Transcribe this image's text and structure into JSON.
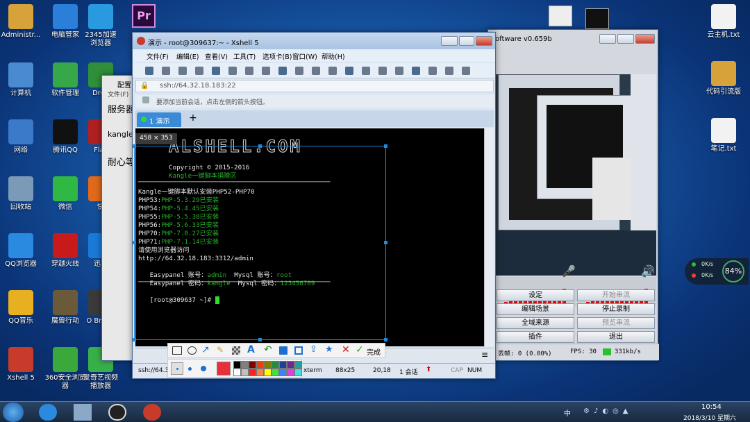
{
  "desktop_icons": [
    {
      "label": "Administr...",
      "color": "#d8a23a"
    },
    {
      "label": "电脑管家",
      "color": "#2a7fd8"
    },
    {
      "label": "2345加速浏览器",
      "color": "#2a9ae0"
    },
    {
      "label": "计算机",
      "color": "#4a8ad0"
    },
    {
      "label": "软件管理",
      "color": "#37a84a"
    },
    {
      "label": "Drea",
      "color": "#2f8f3a"
    },
    {
      "label": "网络",
      "color": "#3a7ac8"
    },
    {
      "label": "腾讯QQ",
      "color": "#111111"
    },
    {
      "label": "Flas",
      "color": "#b02020"
    },
    {
      "label": "回收站",
      "color": "#7a9ab8"
    },
    {
      "label": "微信",
      "color": "#2fb843"
    },
    {
      "label": "快",
      "color": "#e06a1a"
    },
    {
      "label": "QQ浏览器",
      "color": "#2a8ae0"
    },
    {
      "label": "穿越火线",
      "color": "#c81a1a"
    },
    {
      "label": "迅雷",
      "color": "#1a7ad8"
    },
    {
      "label": "QQ音乐",
      "color": "#e8b020"
    },
    {
      "label": "魔兽行动",
      "color": "#6a5a3a"
    },
    {
      "label": "O Brows",
      "color": "#3a3a3a"
    },
    {
      "label": "Xshell 5",
      "color": "#c83a2a"
    },
    {
      "label": "360安全浏览器",
      "color": "#3aa83a"
    },
    {
      "label": "爱奇艺视频播放器",
      "color": "#38b04a"
    }
  ],
  "right_icons": [
    {
      "label": "云主机.txt"
    },
    {
      "label": "代码引流版"
    },
    {
      "label": "笔记.txt"
    }
  ],
  "bg_window": {
    "title": "配置",
    "menu": "文件(F)",
    "line1": "服务器",
    "line2": "kangle",
    "line3": "耐心等"
  },
  "right_window": {
    "title": "oftware v0.659b",
    "buttons": [
      {
        "left": "设定",
        "right": "开始串流"
      },
      {
        "left": "编辑场景",
        "right": "停止录制"
      },
      {
        "left": "全域来源",
        "right": "预览串流"
      },
      {
        "left": "插件",
        "right": "退出"
      }
    ],
    "status": {
      "drop": "丢帧: 0 (0.00%)",
      "fps": "FPS: 30",
      "rate": "331kb/s"
    }
  },
  "xshell": {
    "title": "演示 - root@309637:~ - Xshell 5",
    "menu": [
      "文件(F)",
      "编辑(E)",
      "查看(V)",
      "工具(T)",
      "选项卡(B)",
      "窗口(W)",
      "帮助(H)"
    ],
    "address": "ssh://64.32.18.183:22",
    "hint": "要添加当前会话，点击左侧的箭头按钮。",
    "tab": "1 演示",
    "status_left": "ssh://64.3",
    "status_items": [
      "xterm",
      "88x25",
      "20,18",
      "1 会话",
      "CAP",
      "NUM"
    ],
    "term": {
      "logo": "ALSHELL.COM",
      "copyright": "Copyright © 2015-2016",
      "tagline": "Kangle一键脚本捐赠区",
      "divider": "──────────────────────────────────────────────────",
      "heading": "Kangle一键脚本默认安装PHP52-PHP70",
      "php": [
        {
          "k": "PHP53:",
          "v": "PHP-5.3.29已安装"
        },
        {
          "k": "PHP54:",
          "v": "PHP-5.4.45已安装"
        },
        {
          "k": "PHP55:",
          "v": "PHP-5.5.38已安装"
        },
        {
          "k": "PHP56:",
          "v": "PHP-5.6.33已安装"
        },
        {
          "k": "PHP70:",
          "v": "PHP-7.0.27已安装"
        },
        {
          "k": "PHP71:",
          "v": "PHP-7.1.14已安装"
        }
      ],
      "access": "请使用浏览器访问",
      "url": "http://64.32.18.183:3312/admin",
      "ep_user_k": "Easypanel 账号：",
      "ep_user_v": "admin",
      "my_user_k": "  Mysql 账号：",
      "my_user_v": "root",
      "ep_pass_k": "Easypanel 密码：",
      "ep_pass_v": "kangle",
      "my_pass_k": "  Mysql 密码：",
      "my_pass_v": "123456789",
      "prompt": "[root@309637 ~]# "
    }
  },
  "snip": {
    "size": "458 × 353",
    "done": "完成",
    "accent": "#1e8ae0",
    "current_color": "#e8303a",
    "palette_top": [
      "#000000",
      "#808080",
      "#800000",
      "#e84010",
      "#808000",
      "#1f8f3f",
      "#2040a0",
      "#6a2a8a",
      "#20a0a0"
    ],
    "palette_bottom": [
      "#ffffff",
      "#c0c0c0",
      "#ff2020",
      "#ff8040",
      "#ffff00",
      "#40e040",
      "#4080ff",
      "#e040e0",
      "#40e0e0"
    ]
  },
  "speed": {
    "up": "0K/s",
    "down": "0K/s",
    "pct": "84%"
  },
  "taskbar": {
    "time": "10:54",
    "date": "2018/3/10 星期六",
    "tray": "中"
  }
}
